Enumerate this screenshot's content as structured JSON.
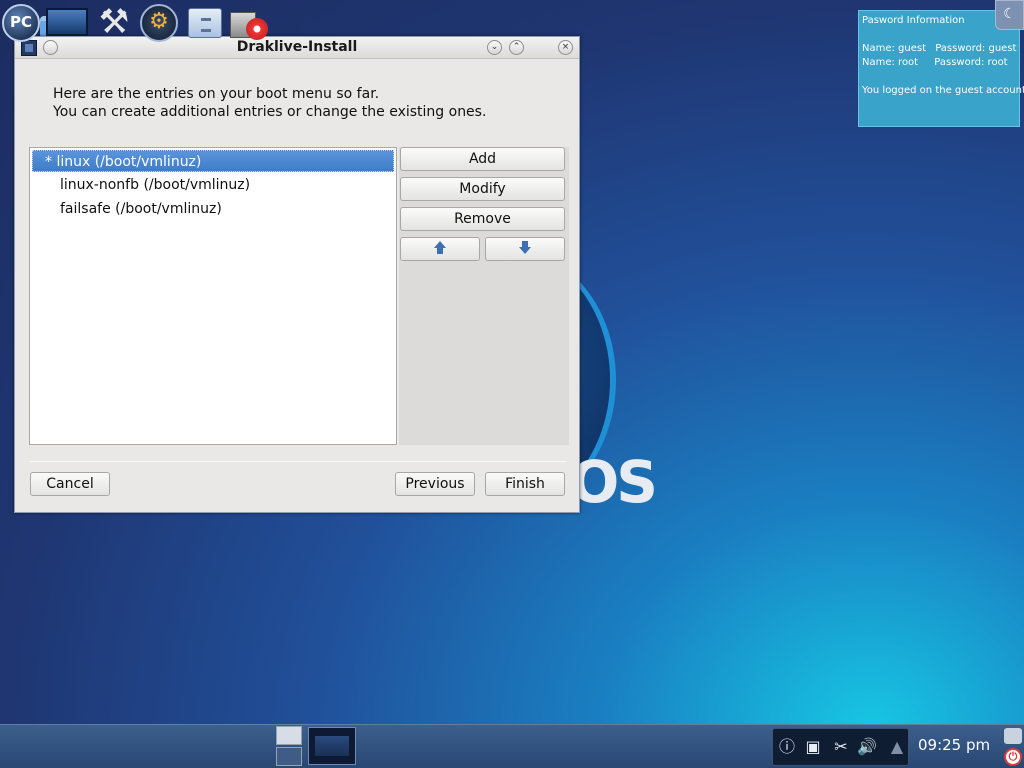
{
  "dialog": {
    "title": "Draklive-Install",
    "intro_line1": "Here are the entries on your boot menu so far.",
    "intro_line2": "You can create additional entries or change the existing ones.",
    "entries": [
      {
        "label": "*  linux (/boot/vmlinuz)",
        "selected": true
      },
      {
        "label": "linux-nonfb (/boot/vmlinuz)",
        "selected": false
      },
      {
        "label": "failsafe (/boot/vmlinuz)",
        "selected": false
      }
    ],
    "buttons": {
      "add": "Add",
      "modify": "Modify",
      "remove": "Remove",
      "cancel": "Cancel",
      "previous": "Previous",
      "finish": "Finish"
    }
  },
  "password_panel": {
    "title": "Pasword Information",
    "guest_name": "Name: guest",
    "guest_password": "Password: guest",
    "root_name": "Name: root",
    "root_password": "Password: root",
    "logged_message": "You logged on the guest account"
  },
  "desktop": {
    "logo_text": "OS"
  },
  "taskbar": {
    "menu_label": "PC",
    "clock": "09:25 pm",
    "tray_icons": [
      "info-icon",
      "network-icon",
      "clipboard-icon",
      "volume-icon",
      "updates-icon"
    ]
  },
  "colors": {
    "selection": "#3f7cc8",
    "password_panel_bg": "#3aa3c9",
    "taskbar_bg": "#2a4773"
  }
}
